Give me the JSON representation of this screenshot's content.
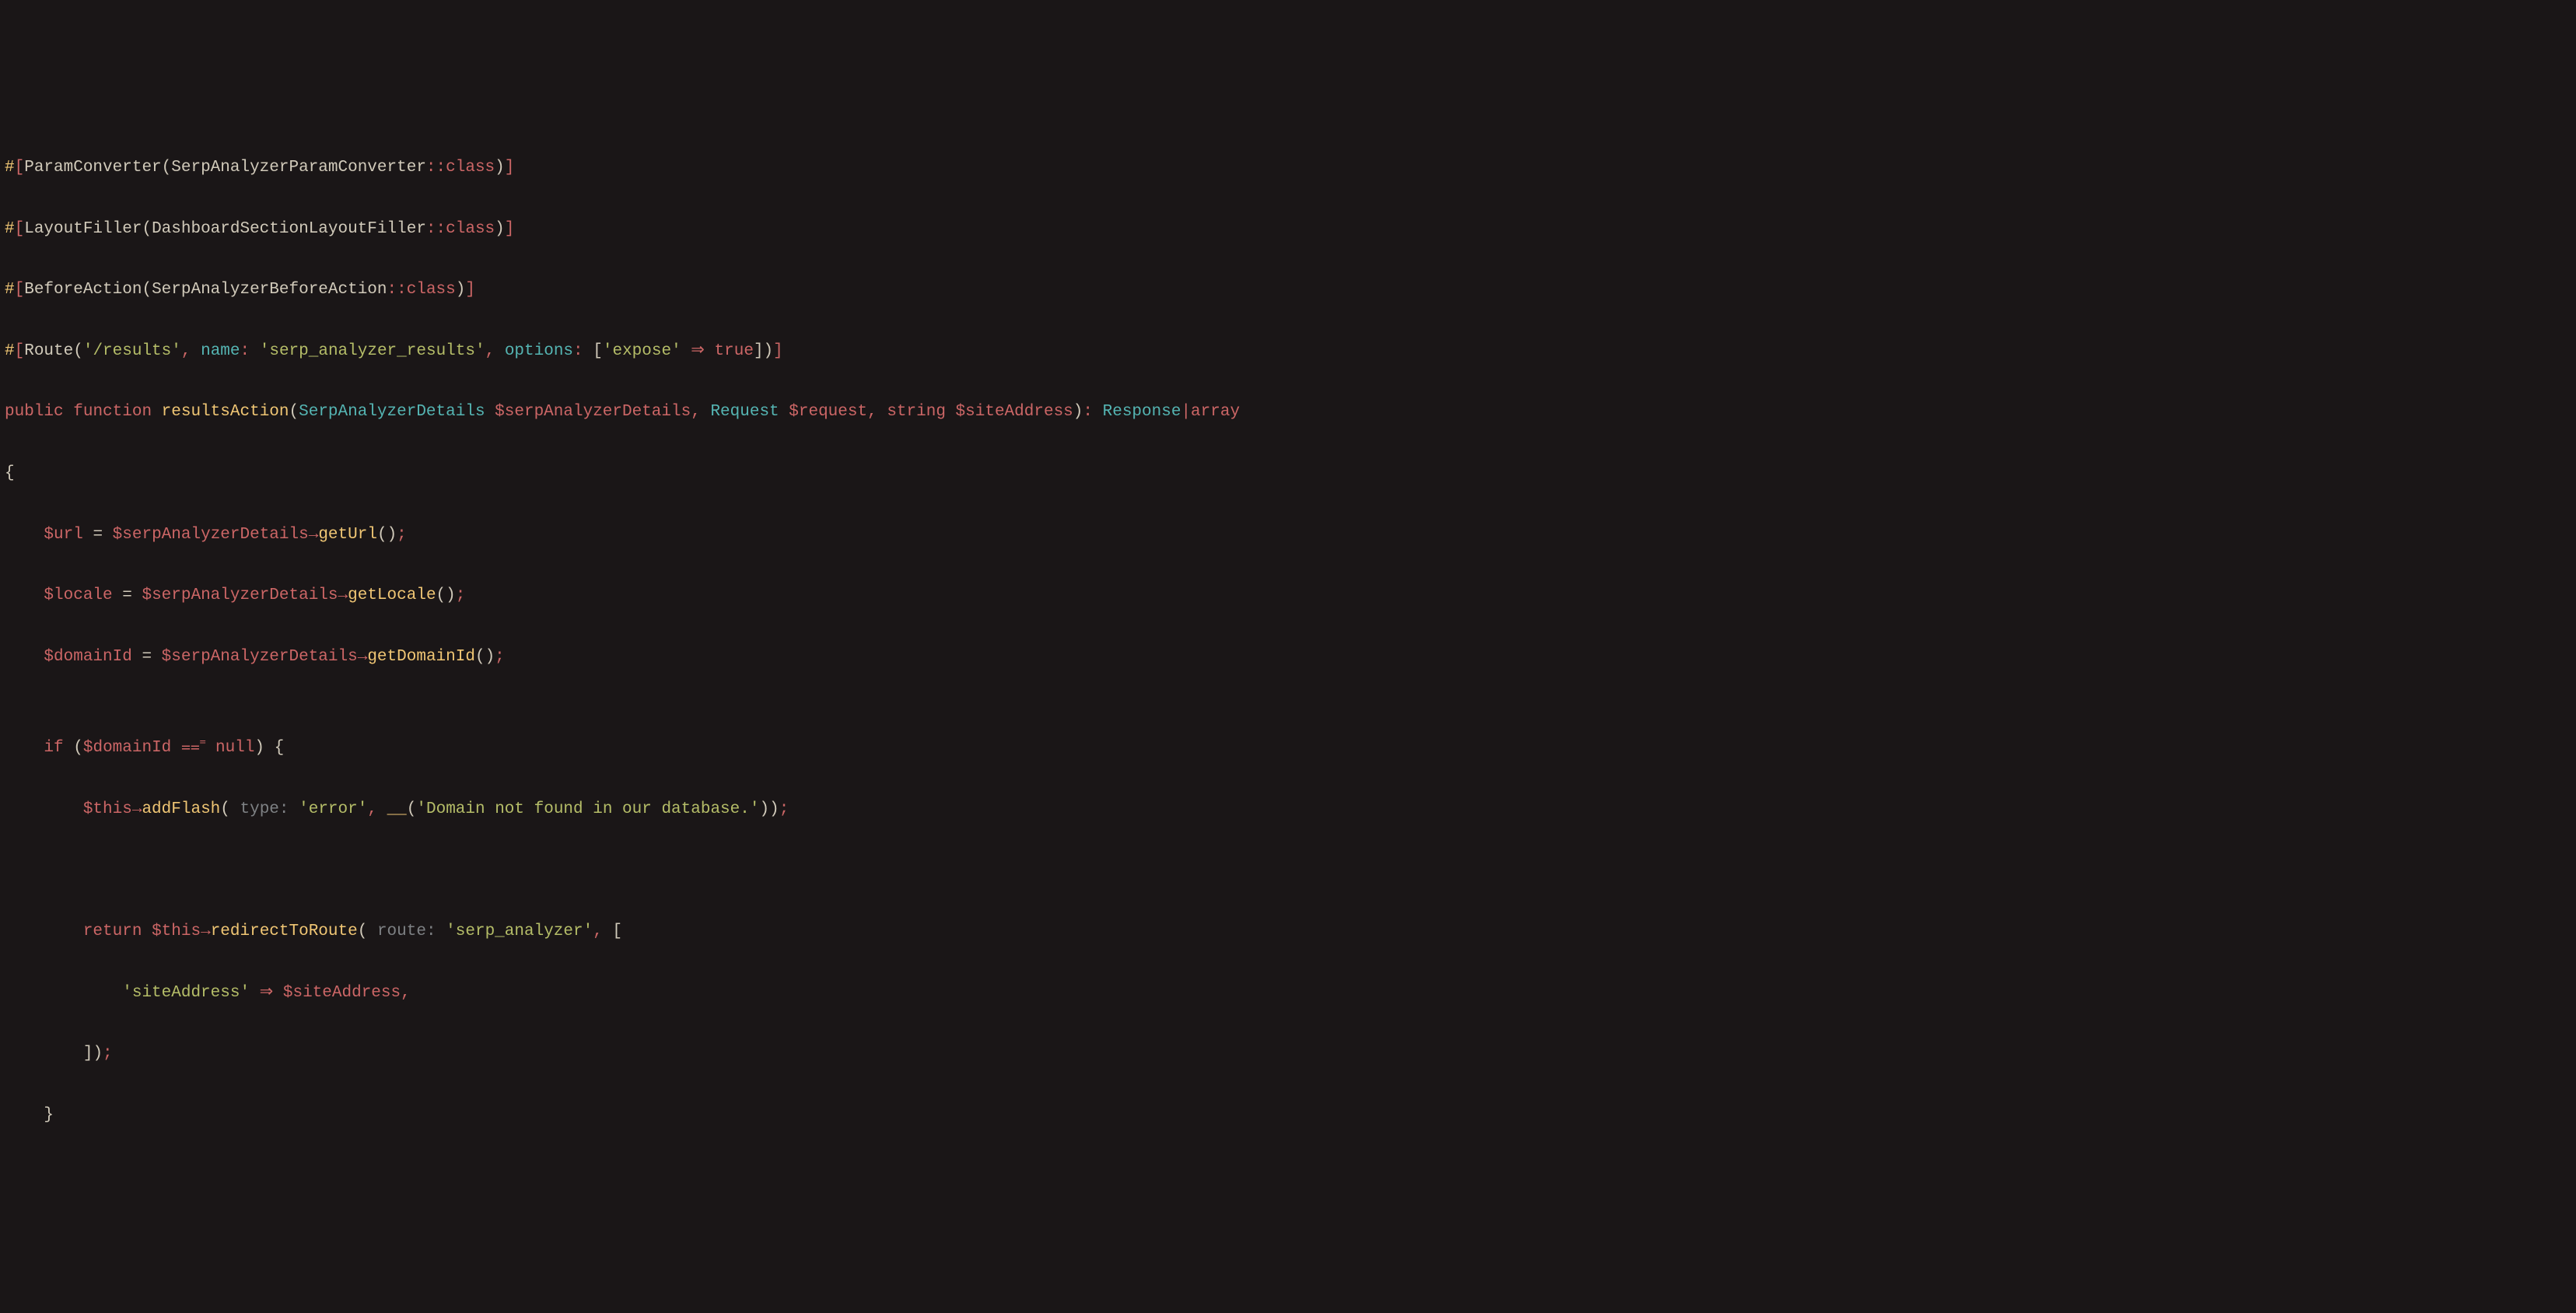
{
  "lines": {
    "l1": {
      "hash": "#",
      "lb": "[",
      "attr": "ParamConverter",
      "lp": "(",
      "cls": "SerpAnalyzerParamConverter",
      "dc": "::",
      "ckw": "class",
      "rp": ")",
      "rb": "]"
    },
    "l2": {
      "hash": "#",
      "lb": "[",
      "attr": "LayoutFiller",
      "lp": "(",
      "cls": "DashboardSectionLayoutFiller",
      "dc": "::",
      "ckw": "class",
      "rp": ")",
      "rb": "]"
    },
    "l3": {
      "hash": "#",
      "lb": "[",
      "attr": "BeforeAction",
      "lp": "(",
      "cls": "SerpAnalyzerBeforeAction",
      "dc": "::",
      "ckw": "class",
      "rp": ")",
      "rb": "]"
    },
    "l4": {
      "hash": "#",
      "lb": "[",
      "attr": "Route",
      "lp": "(",
      "path": "'/results'",
      "c1": ",",
      "sp1": " ",
      "kname": "name",
      "col1": ":",
      "sp2": " ",
      "vname": "'serp_analyzer_results'",
      "c2": ",",
      "sp3": " ",
      "kopts": "options",
      "col2": ":",
      "sp4": " ",
      "lsq": "[",
      "kexp": "'expose'",
      "sp5": " ",
      "fat": "⇒",
      "sp6": " ",
      "vtrue": "true",
      "rsq": "]",
      "rp": ")",
      "rb": "]"
    },
    "l5": {
      "pub": "public",
      "sp1": " ",
      "fn": "function",
      "sp2": " ",
      "name": "resultsAction",
      "lp": "(",
      "t1": "SerpAnalyzerDetails",
      "sp3": " ",
      "v1": "$serpAnalyzerDetails",
      "c1": ",",
      "sp4": " ",
      "t2": "Request",
      "sp5": " ",
      "v2": "$request",
      "c2": ",",
      "sp6": " ",
      "t3": "string",
      "sp7": " ",
      "v3": "$siteAddress",
      "rp": ")",
      "col": ":",
      "sp8": " ",
      "rt1": "Response",
      "pipe": "|",
      "rt2": "array"
    },
    "l6": {
      "brace": "{"
    },
    "l7": {
      "indent": "    ",
      "v": "$url",
      "sp1": " ",
      "eq": "=",
      "sp2": " ",
      "src": "$serpAnalyzerDetails",
      "arr": "→",
      "m": "getUrl",
      "lp": "(",
      "rp": ")",
      "semi": ";"
    },
    "l8": {
      "indent": "    ",
      "v": "$locale",
      "sp1": " ",
      "eq": "=",
      "sp2": " ",
      "src": "$serpAnalyzerDetails",
      "arr": "→",
      "m": "getLocale",
      "lp": "(",
      "rp": ")",
      "semi": ";"
    },
    "l9": {
      "indent": "    ",
      "v": "$domainId",
      "sp1": " ",
      "eq": "=",
      "sp2": " ",
      "src": "$serpAnalyzerDetails",
      "arr": "→",
      "m": "getDomainId",
      "lp": "(",
      "rp": ")",
      "semi": ";"
    },
    "l10": {
      "blank": ""
    },
    "l11": {
      "indent": "    ",
      "if": "if",
      "sp1": " ",
      "lp": "(",
      "v": "$domainId",
      "sp2": " ",
      "eqeq": "⩵⁼",
      "sp3": " ",
      "nul": "null",
      "rp": ")",
      "sp4": " ",
      "brace": "{"
    },
    "l12": {
      "indent": "        ",
      "this": "$this",
      "arr": "→",
      "m": "addFlash",
      "lp": "(",
      "hint_lp_sp": " ",
      "hint": "type:",
      "hsp": " ",
      "s1": "'error'",
      "c1": ",",
      "sp1": " ",
      "uu": "__",
      "lp2": "(",
      "s2": "'Domain not found in our database.'",
      "rp2": ")",
      "rp": ")",
      "semi": ";"
    },
    "l13": {
      "indent": "        ",
      "blank": ""
    },
    "l14": {
      "indent": "        ",
      "ret": "return",
      "sp1": " ",
      "this": "$this",
      "arr": "→",
      "m": "redirectToRoute",
      "lp": "(",
      "hint_lp_sp": " ",
      "hint": "route:",
      "hsp": " ",
      "s1": "'serp_analyzer'",
      "c1": ",",
      "sp2": " ",
      "lsq": "["
    },
    "l15": {
      "indent": "            ",
      "k": "'siteAddress'",
      "sp1": " ",
      "fat": "⇒",
      "sp2": " ",
      "v": "$siteAddress",
      "c": ","
    },
    "l16": {
      "indent": "        ",
      "rsq": "]",
      "rp": ")",
      "semi": ";"
    },
    "l17": {
      "indent": "    ",
      "brace": "}"
    }
  }
}
